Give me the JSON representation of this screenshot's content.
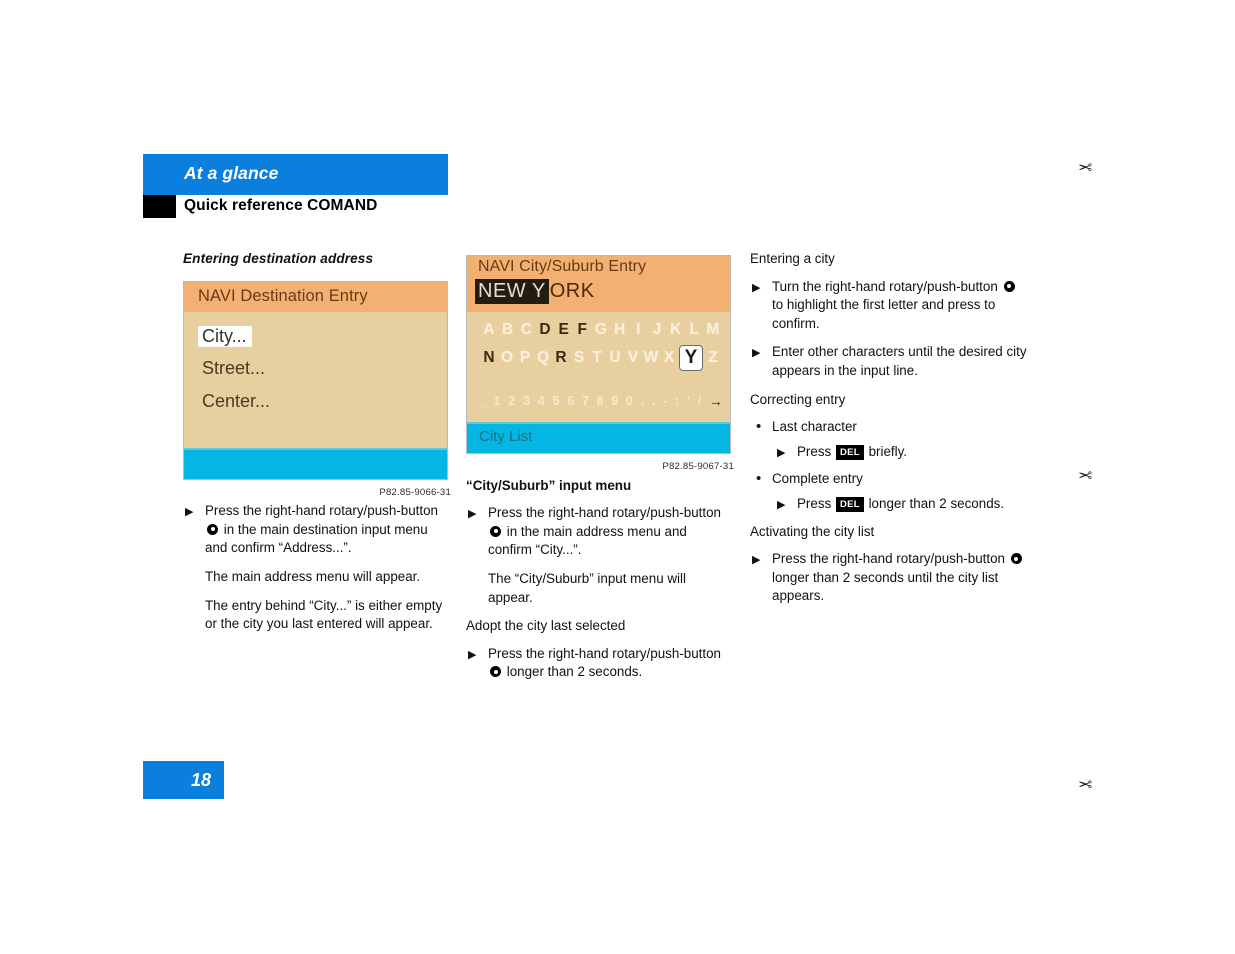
{
  "header": {
    "chapter_title": "At a glance",
    "section_title": "Quick reference COMAND",
    "band_color": "#0B7FDE",
    "tab_color": "#000000"
  },
  "footer": {
    "page_number": "18",
    "box_color": "#0B7FDE"
  },
  "cut_marks": [
    "scissors-mark",
    "scissors-mark",
    "scissors-mark"
  ],
  "columns": {
    "left": {
      "heading": "Entering destination address",
      "figure": {
        "name": "navi-destination-entry-screen",
        "title": "NAVI Destination Entry",
        "title_bar_color": "#F2B173",
        "body_color": "#E8CFA0",
        "bottom_bar_color": "#03B6E3",
        "menu_items": [
          {
            "label": "City...",
            "selected": true
          },
          {
            "label": "Street...",
            "selected": false
          },
          {
            "label": "Center...",
            "selected": false
          }
        ],
        "caption": "P82.85-9066-31"
      },
      "steps": [
        {
          "type": "step",
          "parts": [
            {
              "t": "text",
              "v": "Press the right-hand rotary/push-button "
            },
            {
              "t": "rotary"
            },
            {
              "t": "text",
              "v": " in the main destination input menu and confirm “Address...”."
            }
          ]
        },
        {
          "type": "note",
          "parts": [
            {
              "t": "text",
              "v": "The main address menu will appear."
            }
          ]
        },
        {
          "type": "note",
          "parts": [
            {
              "t": "text",
              "v": "The entry behind “City...” is either empty or the city you last entered will appear."
            }
          ]
        }
      ]
    },
    "middle": {
      "figure": {
        "name": "navi-city-suburb-entry-screen",
        "title": "NAVI City/Suburb Entry",
        "title_bar_color": "#F2B173",
        "body_color": "#E8CFA0",
        "bottom_bar_color": "#03B6E3",
        "input_line": {
          "highlighted": "NEW Y",
          "remainder": "ORK"
        },
        "keyboard_rows": [
          [
            "A",
            "B",
            "C",
            "D",
            "E",
            "F",
            "G",
            "H",
            "I",
            "J",
            "K",
            "L",
            "M"
          ],
          [
            "N",
            "O",
            "P",
            "Q",
            "R",
            "S",
            "T",
            "U",
            "V",
            "W",
            "X",
            "Y",
            "Z"
          ]
        ],
        "keyboard_active": [
          "D",
          "E",
          "F",
          "N",
          "R"
        ],
        "keyboard_selected": "Y",
        "number_row": [
          "_",
          "1",
          "2",
          "3",
          "4",
          "5",
          "6",
          "7",
          "8",
          "9",
          "0",
          ",",
          ".",
          "-",
          ";",
          "'",
          "/"
        ],
        "number_row_arrow": "→",
        "bottom_bar_label": "City List",
        "caption": "P82.85-9067-31"
      },
      "heading": "“City/Suburb” input menu",
      "steps": [
        {
          "type": "step",
          "parts": [
            {
              "t": "text",
              "v": "Press the right-hand rotary/push-button "
            },
            {
              "t": "rotary"
            },
            {
              "t": "text",
              "v": " in the main address menu and confirm “City...”."
            }
          ]
        },
        {
          "type": "note",
          "parts": [
            {
              "t": "text",
              "v": "The “City/Suburb” input menu will appear."
            }
          ]
        },
        {
          "type": "subheading",
          "parts": [
            {
              "t": "text",
              "v": "Adopt the city last selected"
            }
          ]
        },
        {
          "type": "step",
          "parts": [
            {
              "t": "text",
              "v": "Press the right-hand rotary/push-button "
            },
            {
              "t": "rotary"
            },
            {
              "t": "text",
              "v": " longer than 2 seconds."
            }
          ]
        }
      ]
    },
    "right": {
      "blocks": [
        {
          "type": "subheading",
          "parts": [
            {
              "t": "text",
              "v": "Entering a city"
            }
          ]
        },
        {
          "type": "step",
          "parts": [
            {
              "t": "text",
              "v": "Turn the right-hand rotary/push-button "
            },
            {
              "t": "rotary"
            },
            {
              "t": "text",
              "v": " to highlight the first letter and press to confirm."
            }
          ]
        },
        {
          "type": "step",
          "parts": [
            {
              "t": "text",
              "v": "Enter other characters until the desired city appears in the input line."
            }
          ]
        },
        {
          "type": "subheading",
          "parts": [
            {
              "t": "text",
              "v": "Correcting entry"
            }
          ]
        },
        {
          "type": "bullet",
          "parts": [
            {
              "t": "text",
              "v": "Last character"
            }
          ]
        },
        {
          "type": "substep",
          "parts": [
            {
              "t": "text",
              "v": "Press "
            },
            {
              "t": "keycap",
              "v": "DEL"
            },
            {
              "t": "text",
              "v": " briefly."
            }
          ]
        },
        {
          "type": "bullet",
          "parts": [
            {
              "t": "text",
              "v": "Complete entry"
            }
          ]
        },
        {
          "type": "substep",
          "parts": [
            {
              "t": "text",
              "v": "Press "
            },
            {
              "t": "keycap",
              "v": "DEL"
            },
            {
              "t": "text",
              "v": " longer than 2 seconds."
            }
          ]
        },
        {
          "type": "subheading",
          "parts": [
            {
              "t": "text",
              "v": "Activating the city list"
            }
          ]
        },
        {
          "type": "step",
          "parts": [
            {
              "t": "text",
              "v": "Press the right-hand rotary/push-button "
            },
            {
              "t": "rotary"
            },
            {
              "t": "text",
              "v": " longer than 2 seconds until the city list appears."
            }
          ]
        }
      ]
    }
  }
}
